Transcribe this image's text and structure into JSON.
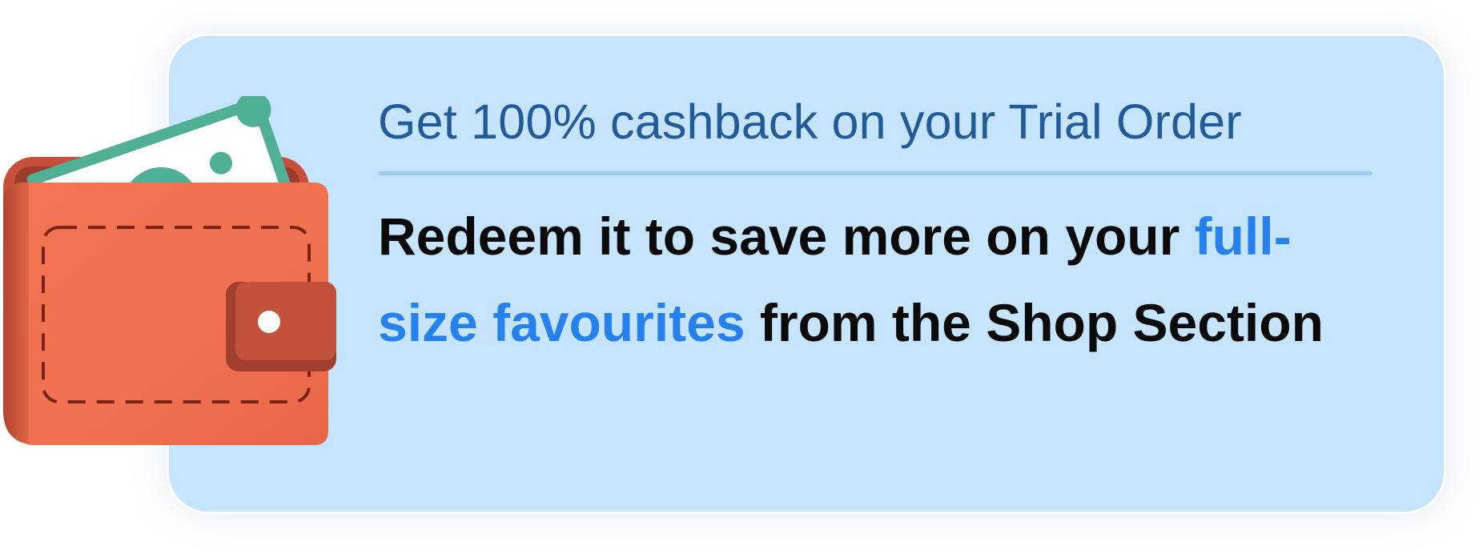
{
  "banner": {
    "headline": "Get 100% cashback on your Trial Order",
    "body_part1": "Redeem it to save more on your ",
    "body_highlight": "full-size favourites",
    "body_part2": " from the Shop Section",
    "currency_symbol": "₹"
  },
  "colors": {
    "card_background": "#c6e4fd",
    "headline": "#225a9a",
    "highlight": "#2781ec",
    "body_text": "#0b0b0b",
    "wallet": "#ef7150",
    "banknote": "#4fb096"
  },
  "icons": {
    "illustration": "wallet-with-cash-icon"
  }
}
